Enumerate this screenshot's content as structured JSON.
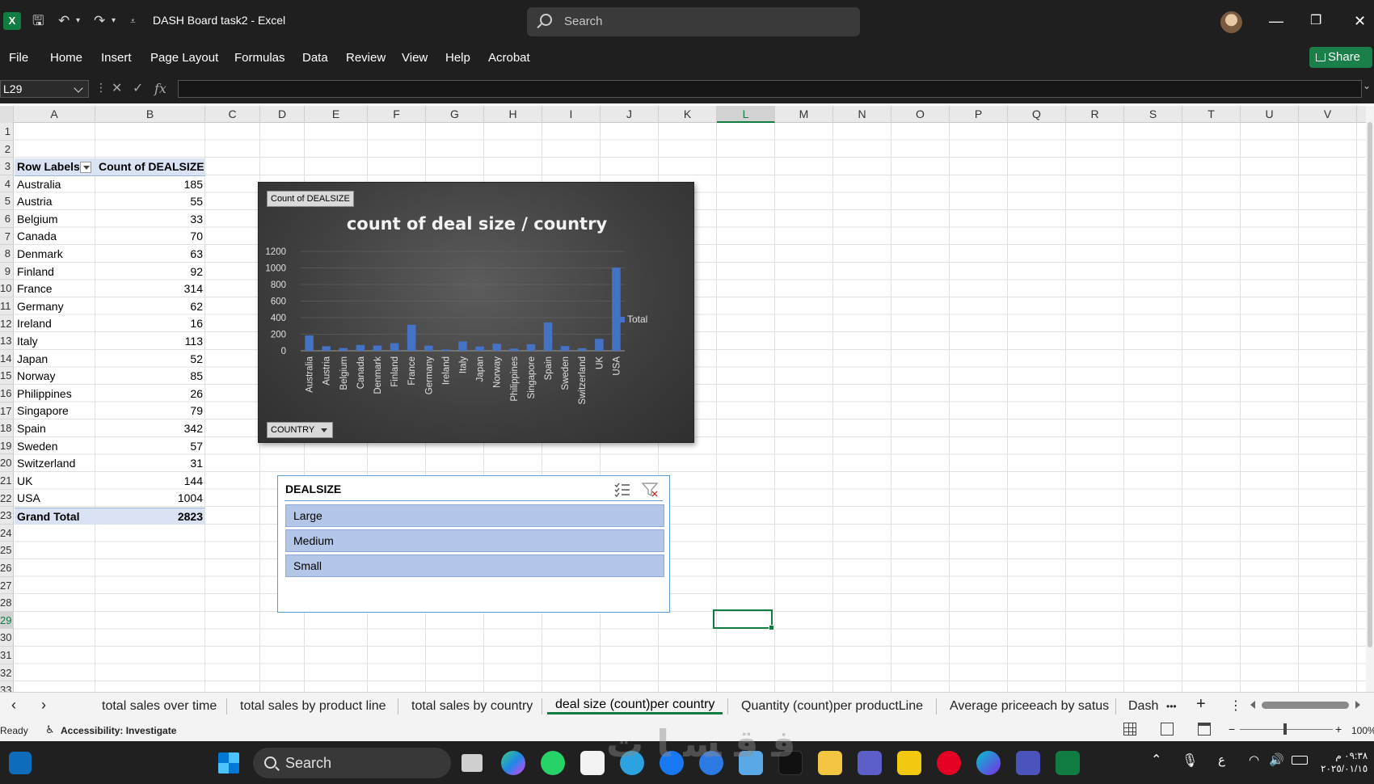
{
  "window": {
    "app_icon": "excel-icon",
    "title": "DASH Board task2  -  Excel",
    "search_placeholder": "Search",
    "minimize": "—",
    "restore": "❐",
    "close": "✕"
  },
  "menu": {
    "items": [
      "File",
      "Home",
      "Insert",
      "Page Layout",
      "Formulas",
      "Data",
      "Review",
      "View",
      "Help",
      "Acrobat"
    ],
    "share_label": "Share"
  },
  "formula_bar": {
    "name_box": "L29",
    "cancel": "✕",
    "enter": "✓",
    "fx": "fx",
    "formula": ""
  },
  "columns": [
    "A",
    "B",
    "C",
    "D",
    "E",
    "F",
    "G",
    "H",
    "I",
    "J",
    "K",
    "L",
    "M",
    "N",
    "O",
    "P",
    "Q",
    "R",
    "S",
    "T",
    "U",
    "V"
  ],
  "rows": [
    "1",
    "2",
    "3",
    "4",
    "5",
    "6",
    "7",
    "8",
    "9",
    "10",
    "11",
    "12",
    "13",
    "14",
    "15",
    "16",
    "17",
    "18",
    "19",
    "20",
    "21",
    "22",
    "23",
    "24",
    "25",
    "26",
    "27",
    "28",
    "29",
    "30",
    "31",
    "32",
    "33"
  ],
  "selected_column": "L",
  "selected_row": "29",
  "pivot": {
    "header_label": "Row Labels",
    "header_value": "Count of DEALSIZE",
    "rows": [
      {
        "label": "Australia",
        "value": "185"
      },
      {
        "label": "Austria",
        "value": "55"
      },
      {
        "label": "Belgium",
        "value": "33"
      },
      {
        "label": "Canada",
        "value": "70"
      },
      {
        "label": "Denmark",
        "value": "63"
      },
      {
        "label": "Finland",
        "value": "92"
      },
      {
        "label": "France",
        "value": "314"
      },
      {
        "label": "Germany",
        "value": "62"
      },
      {
        "label": "Ireland",
        "value": "16"
      },
      {
        "label": "Italy",
        "value": "113"
      },
      {
        "label": "Japan",
        "value": "52"
      },
      {
        "label": "Norway",
        "value": "85"
      },
      {
        "label": "Philippines",
        "value": "26"
      },
      {
        "label": "Singapore",
        "value": "79"
      },
      {
        "label": "Spain",
        "value": "342"
      },
      {
        "label": "Sweden",
        "value": "57"
      },
      {
        "label": "Switzerland",
        "value": "31"
      },
      {
        "label": "UK",
        "value": "144"
      },
      {
        "label": "USA",
        "value": "1004"
      }
    ],
    "total_label": "Grand Total",
    "total_value": "2823"
  },
  "chart_data": {
    "type": "bar",
    "title": "count of deal size / country",
    "value_field_button": "Count of DEALSIZE",
    "axis_field_button": "COUNTRY",
    "categories": [
      "Australia",
      "Austria",
      "Belgium",
      "Canada",
      "Denmark",
      "Finland",
      "France",
      "Germany",
      "Ireland",
      "Italy",
      "Japan",
      "Norway",
      "Philippines",
      "Singapore",
      "Spain",
      "Sweden",
      "Switzerland",
      "UK",
      "USA"
    ],
    "series": [
      {
        "name": "Total",
        "values": [
          185,
          55,
          33,
          70,
          63,
          92,
          314,
          62,
          16,
          113,
          52,
          85,
          26,
          79,
          342,
          57,
          31,
          144,
          1004
        ],
        "color": "#4472c4"
      }
    ],
    "ylim": [
      0,
      1200
    ],
    "yticks": [
      0,
      200,
      400,
      600,
      800,
      1000,
      1200
    ],
    "legend": "right",
    "grid": true,
    "background": "#3e3e3e"
  },
  "slicer": {
    "title": "DEALSIZE",
    "multiselect_icon": "multiselect-icon",
    "clear_filter_icon": "clear-filter-icon",
    "items": [
      "Large",
      "Medium",
      "Small"
    ]
  },
  "sheet_tabs": {
    "tabs": [
      "total sales over time",
      "total sales by product line",
      "total sales by country",
      "deal size (count)per country",
      "Quantity (count)per productLine",
      "Average priceeach by satus",
      "Dash"
    ],
    "active": "deal size (count)per country",
    "more": "•••",
    "add": "+",
    "prev": "‹",
    "next": "›"
  },
  "status": {
    "ready": "Ready",
    "accessibility": "Accessibility: Investigate",
    "zoom": "100%"
  },
  "taskbar": {
    "search_placeholder": "Search",
    "language": "ع",
    "time": "٠٩:٣٨ م",
    "date": "٢٠٢٥/٠١/١٥"
  },
  "colors": {
    "excel_green": "#107c41",
    "pivot_blue": "#dae3f3",
    "slicer_item": "#b4c6e7",
    "bar": "#4472c4"
  }
}
